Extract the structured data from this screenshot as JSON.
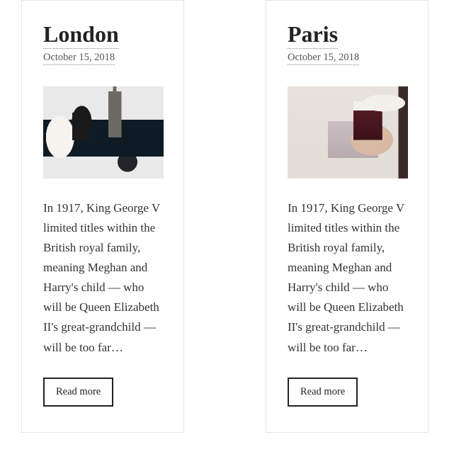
{
  "cards": [
    {
      "title": "London",
      "date": "October 15, 2018",
      "excerpt": "In 1917, King George V limited titles within the British royal family, meaning Meghan and Harry's child — who will be Queen Elizabeth II's great-grandchild — will be too far…",
      "cta": "Read more",
      "image_desc": "Bride and groom standing near a dark sports car with the Eiffel Tower behind them"
    },
    {
      "title": "Paris",
      "date": "October 15, 2018",
      "excerpt": "In 1917, King George V limited titles within the British royal family, meaning Meghan and Harry's child — who will be Queen Elizabeth II's great-grandchild — will be too far…",
      "cta": "Read more",
      "image_desc": "Hand with painted nails holding a dark takeaway coffee cup with a white lid"
    }
  ]
}
